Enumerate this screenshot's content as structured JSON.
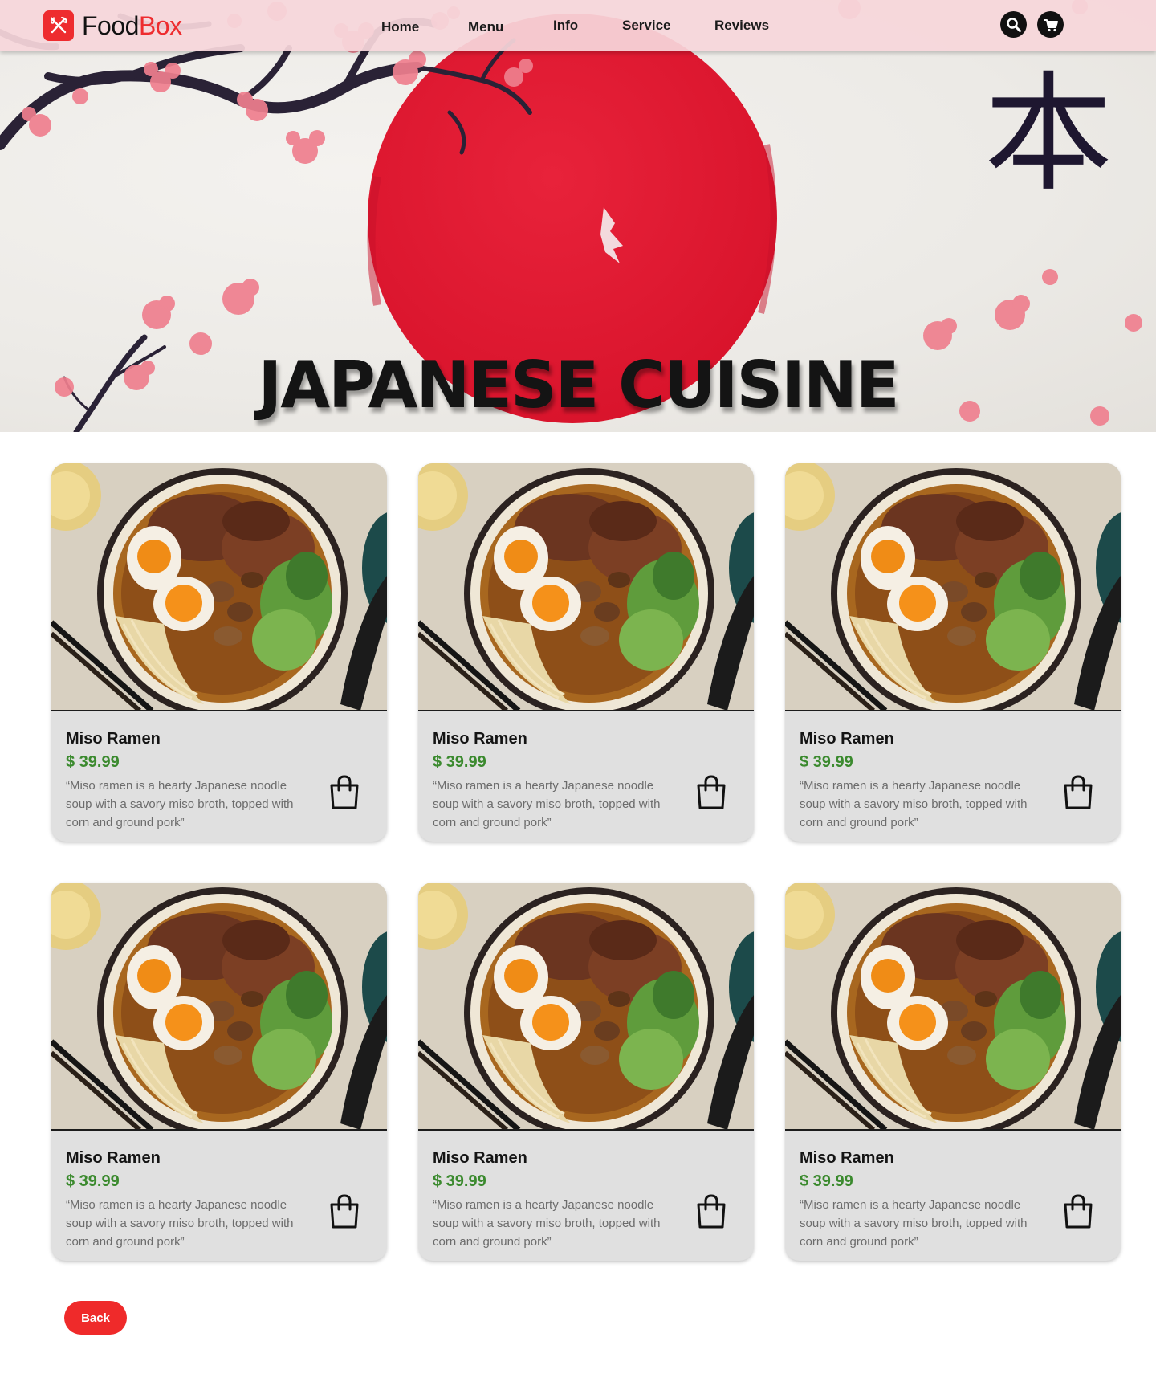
{
  "brand": {
    "name_part1": "Food",
    "name_part2": "Box",
    "accent": "#ee2c2f",
    "icon": "fork-knife-icon"
  },
  "nav": {
    "links": [
      "Home",
      "Menu",
      "Info",
      "Service",
      "Reviews"
    ],
    "search_icon": "search-icon",
    "cart_icon": "cart-icon"
  },
  "hero": {
    "title": "JAPANESE CUISINE",
    "kanji": "本"
  },
  "products": [
    {
      "name": "Miso Ramen",
      "price": "$ 39.99",
      "description": "“Miso ramen is a hearty Japanese noodle soup with a savory miso broth, topped with corn and ground pork”",
      "icon": "shopping-bag-icon"
    },
    {
      "name": "Miso Ramen",
      "price": "$ 39.99",
      "description": "“Miso ramen is a hearty Japanese noodle soup with a savory miso broth, topped with corn and ground pork”",
      "icon": "shopping-bag-icon"
    },
    {
      "name": "Miso Ramen",
      "price": "$ 39.99",
      "description": "“Miso ramen is a hearty Japanese noodle soup with a savory miso broth, topped with corn and ground pork”",
      "icon": "shopping-bag-icon"
    },
    {
      "name": "Miso Ramen",
      "price": "$ 39.99",
      "description": "“Miso ramen is a hearty Japanese noodle soup with a savory miso broth, topped with corn and ground pork”",
      "icon": "shopping-bag-icon"
    },
    {
      "name": "Miso Ramen",
      "price": "$ 39.99",
      "description": "“Miso ramen is a hearty Japanese noodle soup with a savory miso broth, topped with corn and ground pork”",
      "icon": "shopping-bag-icon"
    },
    {
      "name": "Miso Ramen",
      "price": "$ 39.99",
      "description": "“Miso ramen is a hearty Japanese noodle soup with a savory miso broth, topped with corn and ground pork”",
      "icon": "shopping-bag-icon"
    }
  ],
  "back_label": "Back",
  "colors": {
    "price": "#3b8a2e",
    "button": "#ef2a2a",
    "sun": "#e31b32",
    "blossom": "#ef7f8e"
  }
}
